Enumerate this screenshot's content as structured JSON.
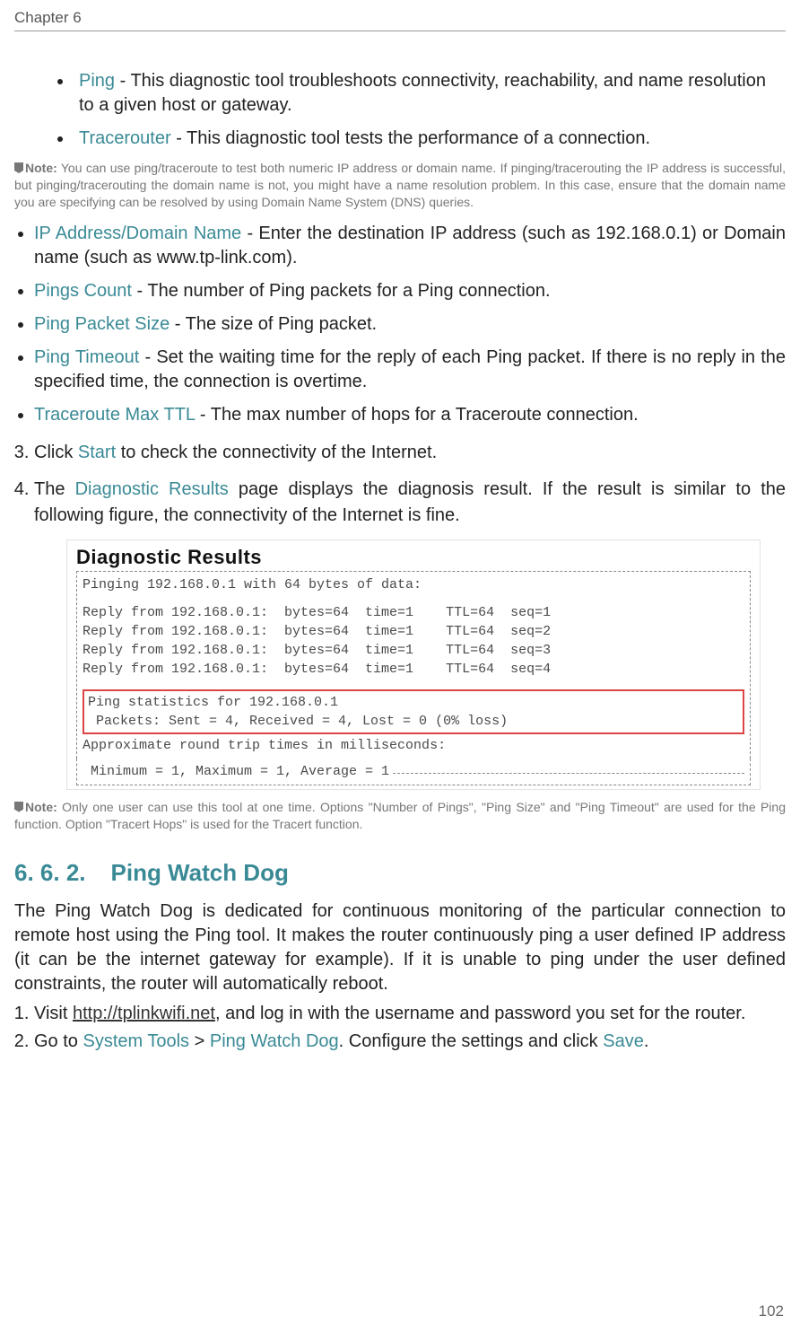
{
  "header": {
    "chapter": "Chapter 6"
  },
  "pingItem": {
    "term": "Ping",
    "desc": " - This diagnostic tool troubleshoots connectivity, reachability, and name resolution to a given host or gateway."
  },
  "traceItem": {
    "term": "Tracerouter",
    "desc": " - This diagnostic tool tests the performance of a connection."
  },
  "note1": {
    "label": "Note:",
    "text": " You can use ping/traceroute to test both numeric IP address or domain name. If pinging/tracerouting the IP address is successful, but pinging/tracerouting the domain name is not, you might have a name resolution problem. In this case, ensure that the domain name you are specifying can be resolved by using Domain Name System (DNS) queries."
  },
  "params": [
    {
      "term": "IP Address/Domain Name",
      "desc": " - Enter the destination IP address (such as 192.168.0.1) or Domain name (such as www.tp-link.com)."
    },
    {
      "term": "Pings Count",
      "desc": " - The number of Ping packets for a Ping connection."
    },
    {
      "term": "Ping Packet Size",
      "desc": " - The size of Ping packet."
    },
    {
      "term": "Ping Timeout",
      "desc": " - Set the waiting time for the reply of each Ping packet. If there is no reply in the specified time, the connection is overtime."
    },
    {
      "term": "Traceroute Max TTL",
      "desc": " - The max number of hops for a Traceroute connection."
    }
  ],
  "step3": {
    "pre": "Click ",
    "btn": "Start",
    "post": " to check the connectivity of the Internet."
  },
  "step4": {
    "pre": "The ",
    "term": "Diagnostic Results",
    "post": " page displays the diagnosis result. If the result is similar to the following figure, the connectivity of the Internet is fine."
  },
  "diag": {
    "title": "Diagnostic Results",
    "line1": "Pinging 192.168.0.1 with 64 bytes of data:",
    "r1": "Reply from 192.168.0.1:  bytes=64  time=1    TTL=64  seq=1",
    "r2": "Reply from 192.168.0.1:  bytes=64  time=1    TTL=64  seq=2",
    "r3": "Reply from 192.168.0.1:  bytes=64  time=1    TTL=64  seq=3",
    "r4": "Reply from 192.168.0.1:  bytes=64  time=1    TTL=64  seq=4",
    "s1": "Ping statistics for 192.168.0.1",
    "s2": " Packets: Sent = 4, Received = 4, Lost = 0 (0% loss)",
    "a1": "Approximate round trip times in milliseconds:",
    "a2": " Minimum = 1, Maximum = 1, Average = 1"
  },
  "note2": {
    "label": "Note:",
    "text": " Only one user can use this tool at one time. Options \"Number of Pings\", \"Ping Size\" and \"Ping Timeout\" are used for the Ping function. Option \"Tracert Hops\" is used for the Tracert function."
  },
  "section": {
    "num": "6. 6. 2.",
    "title": "Ping Watch Dog"
  },
  "pwdPara": "The Ping Watch Dog is dedicated for continuous monitoring of the particular connection to remote host using the Ping tool. It makes the router continuously ping a user defined IP address (it can be the internet gateway for example). If it is unable to ping under the user defined constraints, the router will automatically reboot.",
  "pwdStep1": {
    "pre": "Visit ",
    "url": "http://tplinkwifi.net",
    "post": ", and log in with the username and password you set for the router."
  },
  "pwdStep2": {
    "pre": "Go to ",
    "t1": "System Tools",
    "sep": " > ",
    "t2": "Ping Watch Dog",
    "mid": ". Configure the settings and click ",
    "btn": "Save",
    "end": "."
  },
  "pageNumber": "102"
}
